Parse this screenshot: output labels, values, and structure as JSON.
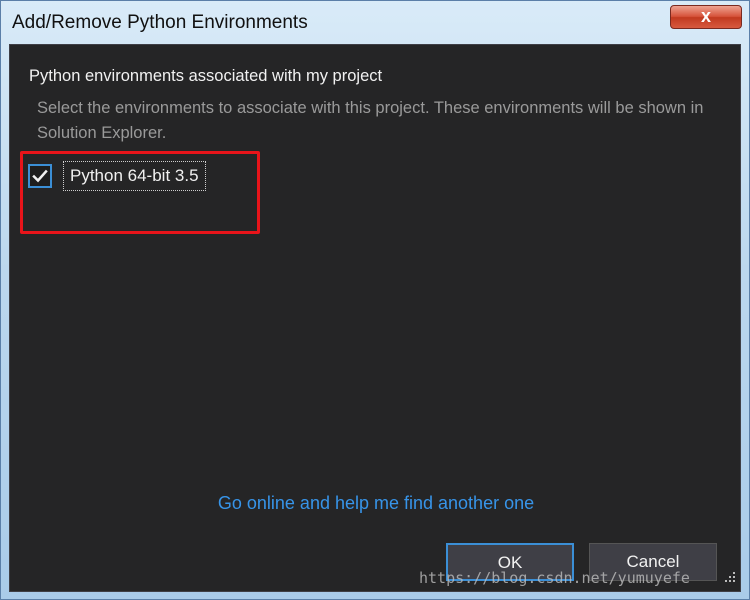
{
  "window": {
    "title": "Add/Remove Python Environments",
    "close_glyph": "x"
  },
  "dialog": {
    "heading": "Python environments associated with my project",
    "description": "Select the environments to associate with this project. These environments will be shown in Solution Explorer.",
    "environments": [
      {
        "label": "Python 64-bit 3.5",
        "checked": true
      }
    ],
    "online_link": "Go online and help me find another one",
    "ok_label": "OK",
    "cancel_label": "Cancel"
  },
  "watermark": "https://blog.csdn.net/yumuyefe",
  "colors": {
    "background": "#252526",
    "accent": "#3b8fd6",
    "link": "#3794e8",
    "highlight": "#e8141a"
  },
  "icons": {
    "checkbox": "checkmark-icon",
    "close": "close-icon",
    "resize": "resize-grip-icon"
  }
}
